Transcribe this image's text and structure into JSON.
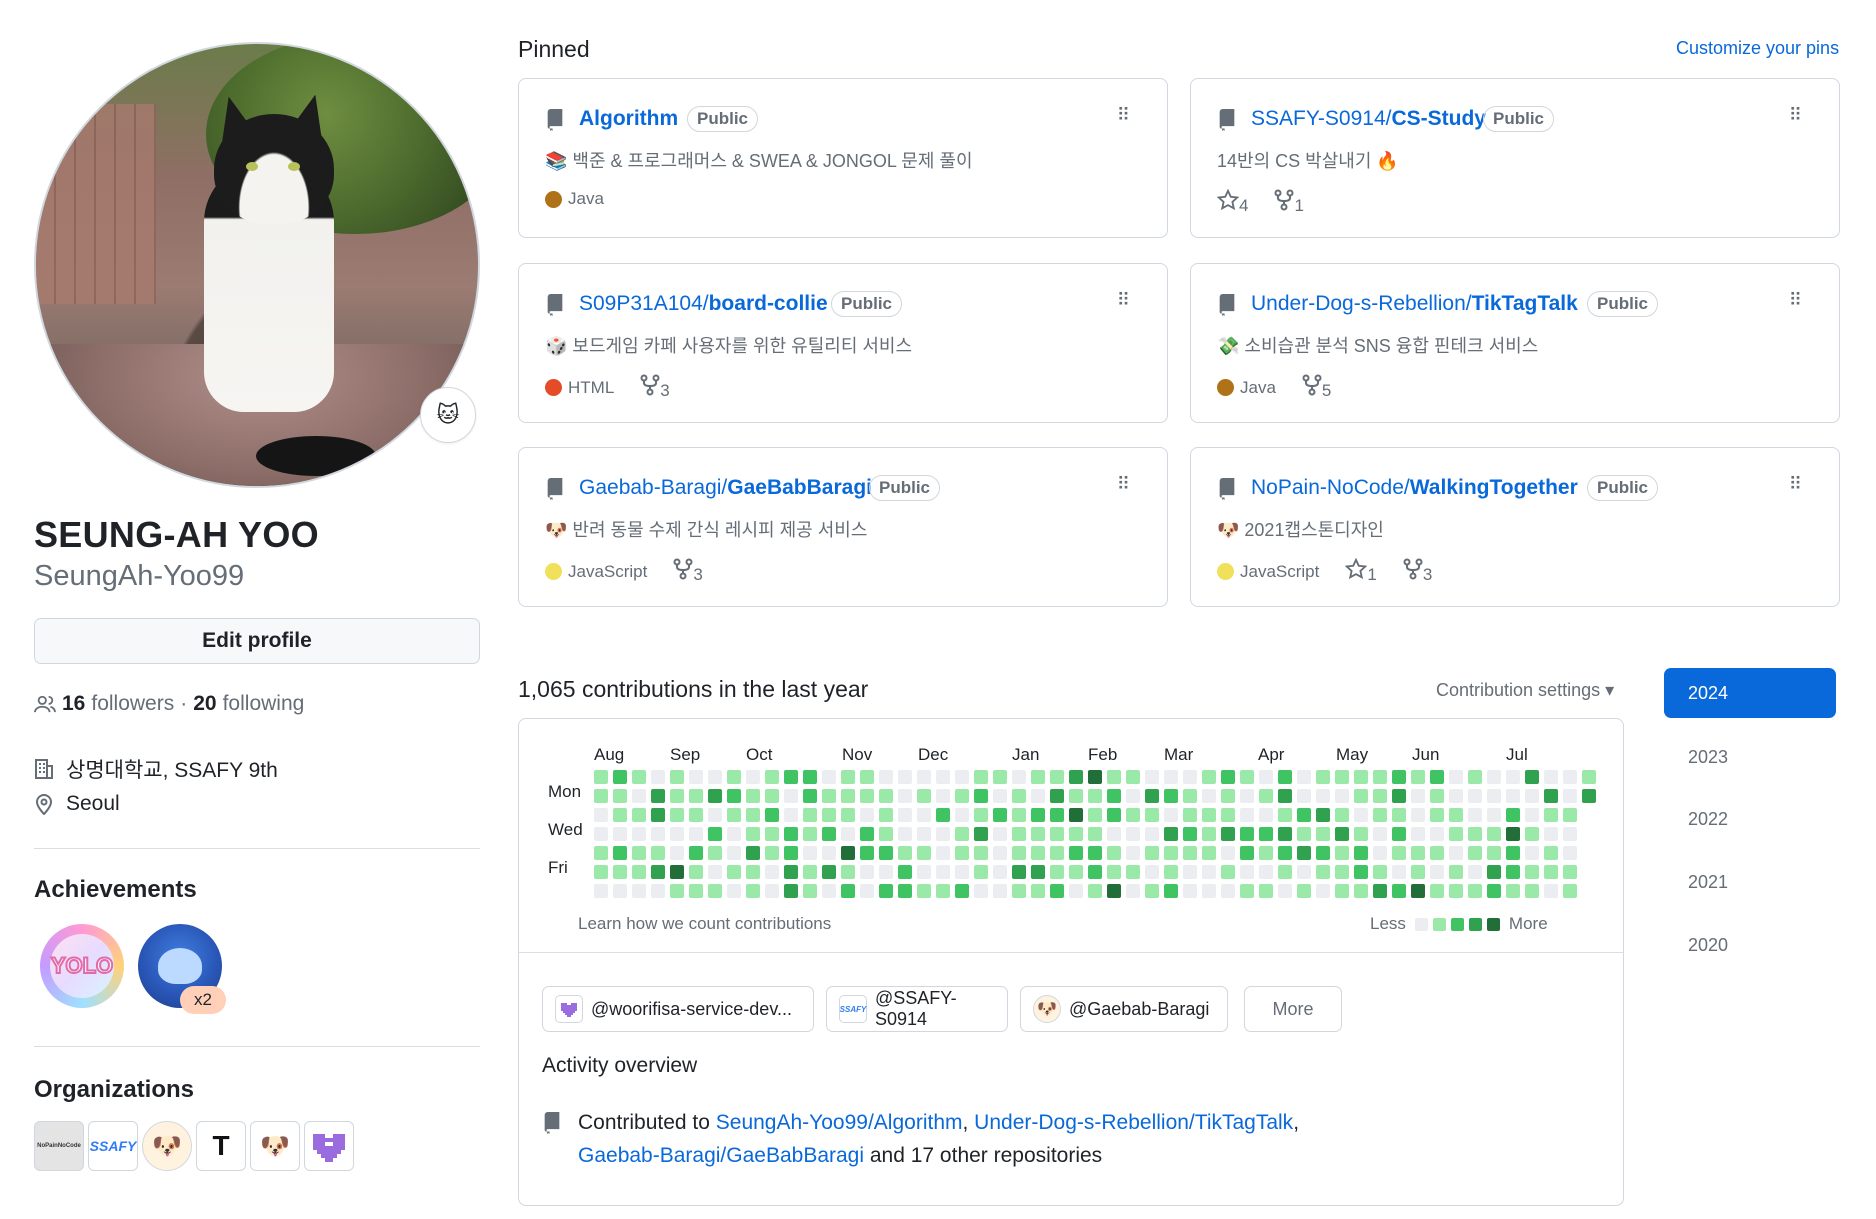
{
  "profile": {
    "name": "SEUNG-AH YOO",
    "login": "SeungAh-Yoo99",
    "status_emoji": "🐱",
    "edit_profile_label": "Edit profile",
    "followers_count": "16",
    "followers_label": "followers",
    "separator": "·",
    "following_count": "20",
    "following_label": "following",
    "organization": "상명대학교, SSAFY 9th",
    "location": "Seoul"
  },
  "achievements": {
    "title": "Achievements",
    "badges": [
      {
        "name": "yolo",
        "label": "YOLO"
      },
      {
        "name": "pull-shark",
        "label": "",
        "multiplier": "x2"
      }
    ]
  },
  "organizations": {
    "title": "Organizations",
    "items": [
      {
        "name": "NoPain-NoCode",
        "label": "NoPainNoCode",
        "color": "#e9e9e9"
      },
      {
        "name": "SSAFY-S0914",
        "label": "SSAFY",
        "color": "#2f7df6"
      },
      {
        "name": "Gaebab-Baragi",
        "label": "🐶",
        "color": "#fbe7c8"
      },
      {
        "name": "Under-Dog-s-Rebellion",
        "label": "T",
        "color": "#111111"
      },
      {
        "name": "board-collie",
        "label": "🐶",
        "color": "#ffffff"
      },
      {
        "name": "woorifisa-service-dev",
        "label": "",
        "color": "#9b6be0"
      }
    ]
  },
  "pinned": {
    "title": "Pinned",
    "customize_label": "Customize your pins",
    "cards": [
      {
        "owner": "",
        "repo": "Algorithm",
        "visibility": "Public",
        "desc": "📚 백준 & 프로그래머스 & SWEA & JONGOL 문제 풀이",
        "lang": "Java",
        "lang_color": "#b07219",
        "stars": "",
        "forks": ""
      },
      {
        "owner": "SSAFY-S0914/",
        "repo": "CS-Study",
        "visibility": "Public",
        "desc": "14반의 CS 박살내기 🔥",
        "lang": "",
        "lang_color": "",
        "stars": "4",
        "forks": "1"
      },
      {
        "owner": "S09P31A104/",
        "repo": "board-collie",
        "visibility": "Public",
        "desc": "🎲 보드게임 카페 사용자를 위한 유틸리티 서비스",
        "lang": "HTML",
        "lang_color": "#e34c26",
        "stars": "",
        "forks": "3"
      },
      {
        "owner": "Under-Dog-s-Rebellion/",
        "repo": "TikTagTalk",
        "visibility": "Public",
        "desc": "💸 소비습관 분석 SNS 융합 핀테크 서비스",
        "lang": "Java",
        "lang_color": "#b07219",
        "stars": "",
        "forks": "5"
      },
      {
        "owner": "Gaebab-Baragi/",
        "repo": "GaeBabBaragi",
        "visibility": "Public",
        "desc": "🐶 반려 동물 수제 간식 레시피 제공 서비스",
        "lang": "JavaScript",
        "lang_color": "#f1e05a",
        "stars": "",
        "forks": "3"
      },
      {
        "owner": "NoPain-NoCode/",
        "repo": "WalkingTogether",
        "visibility": "Public",
        "desc": "🐶 2021캡스톤디자인",
        "lang": "JavaScript",
        "lang_color": "#f1e05a",
        "stars": "1",
        "forks": "3"
      }
    ]
  },
  "contributions": {
    "title": "1,065 contributions in the last year",
    "settings_label": "Contribution settings ▾",
    "months": [
      "Aug",
      "Sep",
      "Oct",
      "Nov",
      "Dec",
      "Jan",
      "Feb",
      "Mar",
      "Apr",
      "May",
      "Jun",
      "Jul"
    ],
    "days": [
      "Mon",
      "Wed",
      "Fri"
    ],
    "learn_label": "Learn how we count contributions",
    "legend_less": "Less",
    "legend_more": "More",
    "colors": [
      "#ebedf0",
      "#9be9a8",
      "#40c463",
      "#30a14e",
      "#216e39"
    ],
    "weeks": 53
  },
  "org_filters": [
    {
      "label": "@woorifisa-service-dev...",
      "icon": "woorifisa-icon"
    },
    {
      "label": "@SSAFY-S0914",
      "icon": "ssafy-icon"
    },
    {
      "label": "@Gaebab-Baragi",
      "icon": "gaebab-icon"
    }
  ],
  "more_label": "More",
  "activity": {
    "title": "Activity overview",
    "prefix": "Contributed to ",
    "repo1": "SeungAh-Yoo99/Algorithm",
    "comma1": ", ",
    "repo2": "Under-Dog-s-Rebellion/TikTagTalk",
    "comma2": ",",
    "repo3": "Gaebab-Baragi/GaeBabBaragi",
    "suffix": " and 17 other repositories"
  },
  "years": [
    "2024",
    "2023",
    "2022",
    "2021",
    "2020"
  ],
  "active_year": "2024"
}
